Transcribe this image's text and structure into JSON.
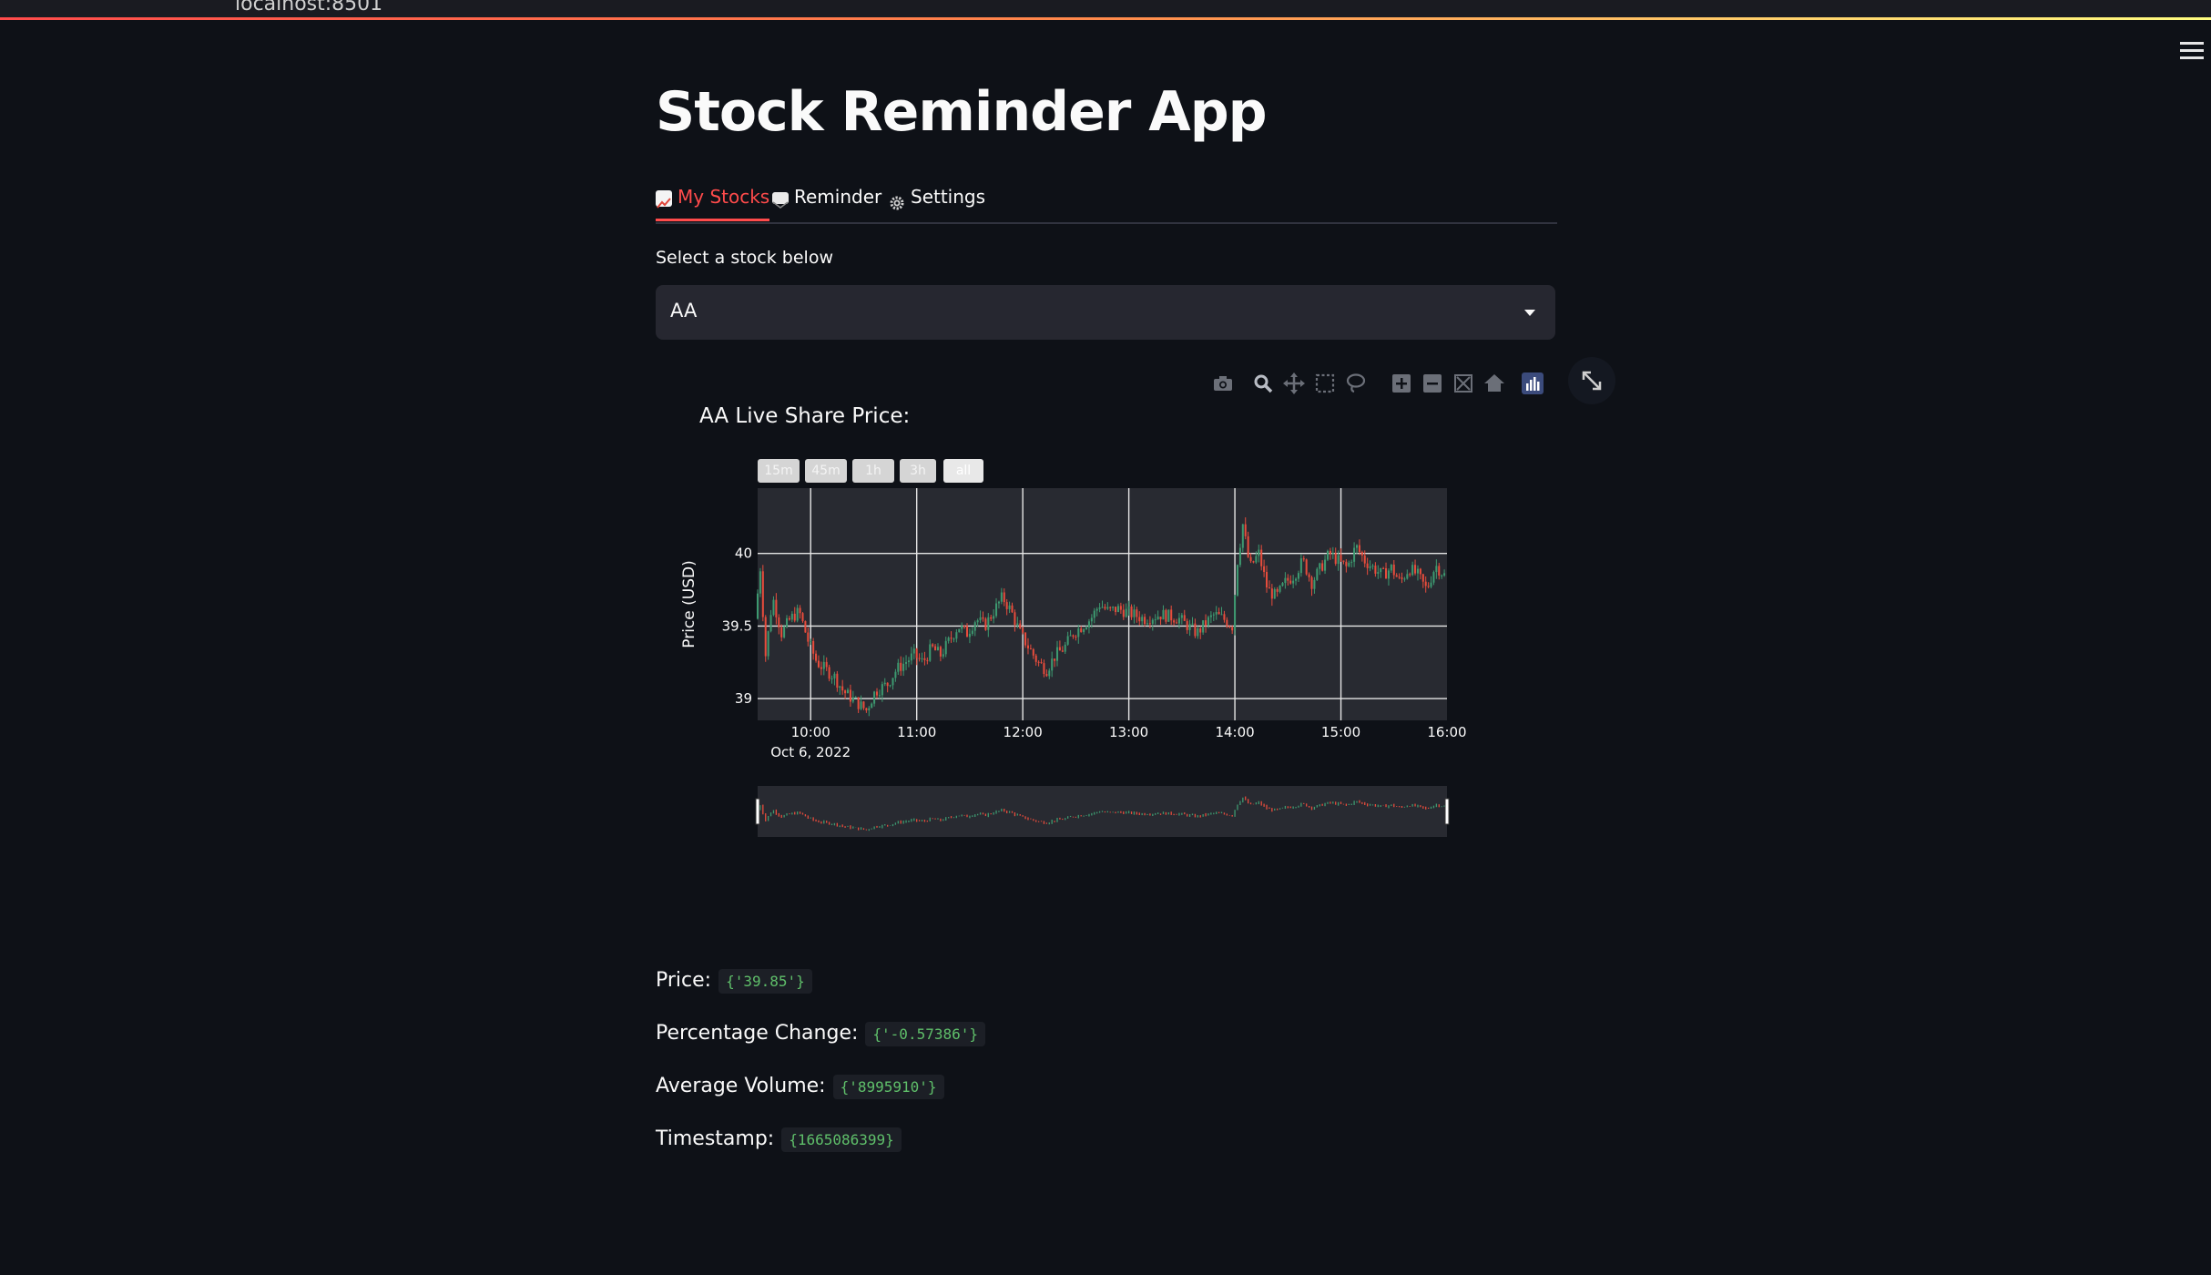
{
  "browser": {
    "url": "localhost:8501"
  },
  "app": {
    "title": "Stock Reminder App"
  },
  "tabs": [
    {
      "label": "My Stocks",
      "icon": "chart-increasing-icon",
      "active": true
    },
    {
      "label": "Reminder",
      "icon": "envelope-icon",
      "active": false
    },
    {
      "label": "Settings",
      "icon": "gear-icon",
      "active": false
    }
  ],
  "select": {
    "label": "Select a stock below",
    "value": "AA"
  },
  "modebar": [
    "camera-icon",
    "zoom-icon",
    "pan-icon",
    "box-select-icon",
    "lasso-select-icon",
    "zoom-in-icon",
    "zoom-out-icon",
    "autoscale-icon",
    "reset-axes-icon",
    "plotly-logo-icon"
  ],
  "range_buttons": [
    "15m",
    "45m",
    "1h",
    "3h",
    "all"
  ],
  "colors": {
    "accent": "#ff4b4b",
    "increasing": "#3d9970",
    "decreasing": "#e74c3c",
    "code_text": "#5fbf6a"
  },
  "chart_data": {
    "type": "candlestick",
    "title": "AA Live Share Price:",
    "ylabel": "Price (USD)",
    "xlabel": "",
    "x_ticks": [
      "10:00",
      "11:00",
      "12:00",
      "13:00",
      "14:00",
      "15:00",
      "16:00"
    ],
    "x_date_label": "Oct 6, 2022",
    "y_ticks": [
      39,
      39.5,
      40
    ],
    "xlim": [
      "09:30",
      "16:00"
    ],
    "ylim": [
      38.85,
      40.45
    ],
    "grid": true,
    "rangeslider": true,
    "close_path": [
      [
        "09:30",
        39.55
      ],
      [
        "09:33",
        39.9
      ],
      [
        "09:36",
        39.3
      ],
      [
        "09:40",
        39.7
      ],
      [
        "09:45",
        39.45
      ],
      [
        "09:50",
        39.55
      ],
      [
        "09:55",
        39.6
      ],
      [
        "10:00",
        39.4
      ],
      [
        "10:05",
        39.25
      ],
      [
        "10:10",
        39.2
      ],
      [
        "10:15",
        39.15
      ],
      [
        "10:20",
        39.05
      ],
      [
        "10:25",
        39.0
      ],
      [
        "10:30",
        38.95
      ],
      [
        "10:33",
        38.92
      ],
      [
        "10:38",
        39.05
      ],
      [
        "10:45",
        39.1
      ],
      [
        "10:50",
        39.2
      ],
      [
        "10:55",
        39.25
      ],
      [
        "11:00",
        39.3
      ],
      [
        "11:05",
        39.25
      ],
      [
        "11:10",
        39.35
      ],
      [
        "11:15",
        39.3
      ],
      [
        "11:20",
        39.4
      ],
      [
        "11:25",
        39.5
      ],
      [
        "11:30",
        39.45
      ],
      [
        "11:35",
        39.55
      ],
      [
        "11:40",
        39.5
      ],
      [
        "11:45",
        39.6
      ],
      [
        "11:50",
        39.7
      ],
      [
        "11:55",
        39.6
      ],
      [
        "12:00",
        39.45
      ],
      [
        "12:05",
        39.35
      ],
      [
        "12:10",
        39.25
      ],
      [
        "12:15",
        39.2
      ],
      [
        "12:20",
        39.3
      ],
      [
        "12:25",
        39.35
      ],
      [
        "12:30",
        39.45
      ],
      [
        "12:35",
        39.5
      ],
      [
        "12:40",
        39.55
      ],
      [
        "12:45",
        39.65
      ],
      [
        "12:50",
        39.6
      ],
      [
        "12:55",
        39.62
      ],
      [
        "13:00",
        39.6
      ],
      [
        "13:10",
        39.55
      ],
      [
        "13:20",
        39.58
      ],
      [
        "13:30",
        39.55
      ],
      [
        "13:35",
        39.5
      ],
      [
        "13:40",
        39.45
      ],
      [
        "13:45",
        39.52
      ],
      [
        "13:50",
        39.58
      ],
      [
        "13:55",
        39.55
      ],
      [
        "14:00",
        39.5
      ],
      [
        "14:03",
        39.95
      ],
      [
        "14:06",
        40.2
      ],
      [
        "14:10",
        39.9
      ],
      [
        "14:15",
        40.0
      ],
      [
        "14:20",
        39.75
      ],
      [
        "14:25",
        39.7
      ],
      [
        "14:30",
        39.8
      ],
      [
        "14:35",
        39.85
      ],
      [
        "14:40",
        39.95
      ],
      [
        "14:45",
        39.8
      ],
      [
        "14:50",
        39.9
      ],
      [
        "14:55",
        40.0
      ],
      [
        "15:00",
        39.95
      ],
      [
        "15:05",
        39.9
      ],
      [
        "15:10",
        40.05
      ],
      [
        "15:15",
        39.95
      ],
      [
        "15:20",
        39.9
      ],
      [
        "15:25",
        39.85
      ],
      [
        "15:30",
        39.9
      ],
      [
        "15:35",
        39.8
      ],
      [
        "15:40",
        39.9
      ],
      [
        "15:45",
        39.85
      ],
      [
        "15:50",
        39.75
      ],
      [
        "15:55",
        39.92
      ],
      [
        "16:00",
        39.85
      ]
    ]
  },
  "metrics": [
    {
      "label": "Price:",
      "value": "{'39.85'}"
    },
    {
      "label": "Percentage Change:",
      "value": "{'-0.57386'}"
    },
    {
      "label": "Average Volume:",
      "value": "{'8995910'}"
    },
    {
      "label": "Timestamp:",
      "value": "{1665086399}"
    }
  ]
}
